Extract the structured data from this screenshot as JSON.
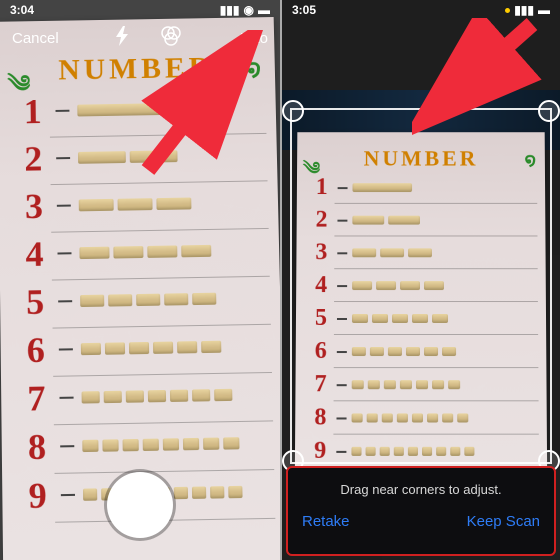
{
  "leftPanel": {
    "time": "3:04",
    "topbar": {
      "cancel": "Cancel",
      "auto": "Auto"
    },
    "doc": {
      "title": "NUMBER",
      "rows": [
        {
          "n": "1",
          "sticks": [
            90
          ]
        },
        {
          "n": "2",
          "sticks": [
            48,
            48
          ]
        },
        {
          "n": "3",
          "sticks": [
            35,
            35,
            35
          ]
        },
        {
          "n": "4",
          "sticks": [
            30,
            30,
            30,
            30
          ]
        },
        {
          "n": "5",
          "sticks": [
            24,
            24,
            24,
            24,
            24
          ]
        },
        {
          "n": "6",
          "sticks": [
            20,
            20,
            20,
            20,
            20,
            20
          ]
        },
        {
          "n": "7",
          "sticks": [
            18,
            18,
            18,
            18,
            18,
            18,
            18
          ]
        },
        {
          "n": "8",
          "sticks": [
            16,
            16,
            16,
            16,
            16,
            16,
            16,
            16
          ]
        },
        {
          "n": "9",
          "sticks": [
            14,
            14,
            14,
            14,
            14,
            14,
            14,
            14,
            14
          ]
        }
      ]
    }
  },
  "rightPanel": {
    "time": "3:05",
    "doc": {
      "title": "NUMBER",
      "rows": [
        {
          "n": "1",
          "sticks": [
            60
          ]
        },
        {
          "n": "2",
          "sticks": [
            32,
            32
          ]
        },
        {
          "n": "3",
          "sticks": [
            24,
            24,
            24
          ]
        },
        {
          "n": "4",
          "sticks": [
            20,
            20,
            20,
            20
          ]
        },
        {
          "n": "5",
          "sticks": [
            16,
            16,
            16,
            16,
            16
          ]
        },
        {
          "n": "6",
          "sticks": [
            14,
            14,
            14,
            14,
            14,
            14
          ]
        },
        {
          "n": "7",
          "sticks": [
            12,
            12,
            12,
            12,
            12,
            12,
            12
          ]
        },
        {
          "n": "8",
          "sticks": [
            11,
            11,
            11,
            11,
            11,
            11,
            11,
            11
          ]
        },
        {
          "n": "9",
          "sticks": [
            10,
            10,
            10,
            10,
            10,
            10,
            10,
            10,
            10
          ]
        }
      ]
    },
    "hint": "Drag near corners to adjust.",
    "retake": "Retake",
    "keep": "Keep Scan"
  },
  "colors": {
    "arrow": "#ef2b3a"
  }
}
